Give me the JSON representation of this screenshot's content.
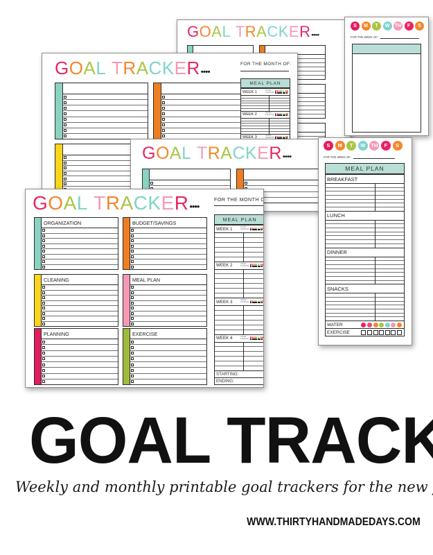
{
  "page": {
    "background": "#ffffff",
    "headline": "GOAL TRACKERS",
    "subheadline": "Weekly and monthly printable goal trackers for the new year!",
    "url": "WWW.THIRTYHANDMADEDAYS.COM"
  },
  "title": {
    "letters": [
      {
        "ch": "G",
        "color": "#e8275f"
      },
      {
        "ch": "O",
        "color": "#f4872c"
      },
      {
        "ch": "A",
        "color": "#a9c544"
      },
      {
        "ch": "L",
        "color": "#7fd4cb"
      },
      {
        "ch": " ",
        "color": "#ffffff"
      },
      {
        "ch": "T",
        "color": "#f59ab5"
      },
      {
        "ch": "R",
        "color": "#f4872c"
      },
      {
        "ch": "A",
        "color": "#a9c544"
      },
      {
        "ch": "C",
        "color": "#7fd4cb"
      },
      {
        "ch": "K",
        "color": "#7fd4cb"
      },
      {
        "ch": "E",
        "color": "#f59ab5"
      },
      {
        "ch": "R",
        "color": "#e8275f"
      }
    ],
    "dots": "••••"
  },
  "monthly_sheet": {
    "month_label": "FOR THE MONTH OF:",
    "categories": [
      {
        "label": "ORGANIZATION",
        "color": "#8ad3c2",
        "rows": 8
      },
      {
        "label": "BUDGET/SAVINGS",
        "color": "#ef7d22",
        "rows": 8
      },
      {
        "label": "CLEANING",
        "color": "#fbd51c",
        "rows": 8
      },
      {
        "label": "MEAL PLAN",
        "color": "#f59ab5",
        "rows": 8
      },
      {
        "label": "PLANNING",
        "color": "#e31c5f",
        "rows": 8
      },
      {
        "label": "EXERCISE",
        "color": "#9fbb3c",
        "rows": 8
      }
    ],
    "meal_plan": {
      "header": "MEAL PLAN",
      "header_color": "#b9ded6",
      "weeks": [
        "WEEK 1",
        "WEEK 2",
        "WEEK 3",
        "WEEK 4"
      ],
      "micro_labels": [
        "WATER",
        "EXERCISE"
      ],
      "water_dot_colors": [
        "#ec1f63",
        "#f0447f",
        "#f4872c",
        "#a9c544",
        "#7fd4cb",
        "#f59ab5",
        "#f4872c"
      ],
      "exercise_boxes": 7,
      "starting_label": "STARTING:",
      "ending_label": "ENDING:"
    }
  },
  "weekly_sheet": {
    "week_label": "FOR THE WEEK OF:",
    "days": [
      {
        "ch": "S",
        "color": "#e31c5f"
      },
      {
        "ch": "M",
        "color": "#f4872c"
      },
      {
        "ch": "T",
        "color": "#a9c544"
      },
      {
        "ch": "W",
        "color": "#7fd4cb"
      },
      {
        "ch": "TH",
        "color": "#f59ab5"
      },
      {
        "ch": "F",
        "color": "#ec1f63"
      },
      {
        "ch": "S",
        "color": "#f4872c"
      }
    ],
    "meal_plan": {
      "header": "MEAL PLAN",
      "header_color": "#b9ded6",
      "sections": [
        "BREAKFAST",
        "LUNCH",
        "DINNER",
        "SNACKS"
      ],
      "water_label": "WATER",
      "exercise_label": "EXERCISE",
      "water_dot_colors": [
        "#ec1f63",
        "#f0447f",
        "#f4872c",
        "#a9c544",
        "#7fd4cb",
        "#f59ab5",
        "#f4872c"
      ],
      "exercise_boxes": 7
    }
  }
}
